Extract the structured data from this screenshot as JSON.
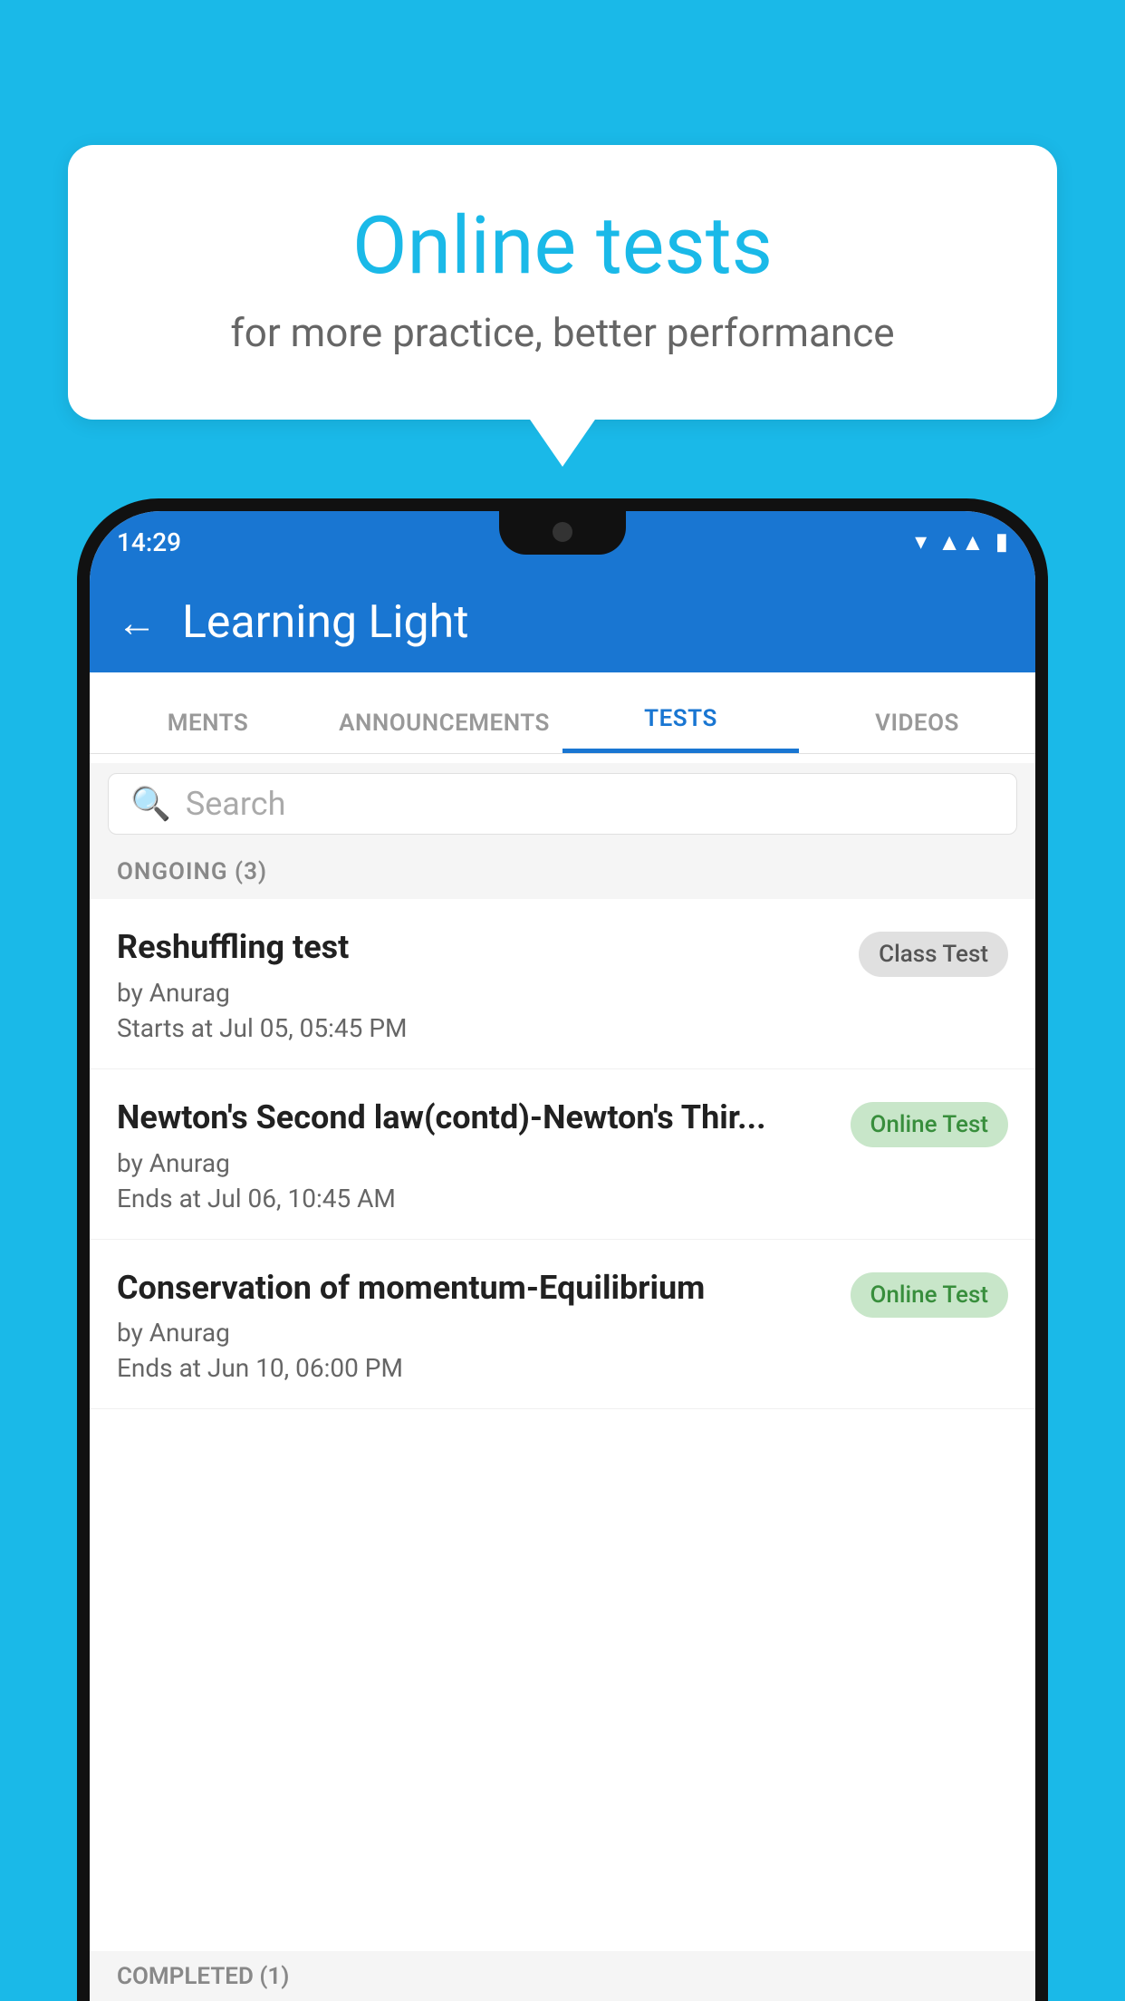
{
  "bubble": {
    "title": "Online tests",
    "subtitle": "for more practice, better performance"
  },
  "statusBar": {
    "time": "14:29",
    "icons": [
      "wifi",
      "signal",
      "battery"
    ]
  },
  "appBar": {
    "title": "Learning Light",
    "backLabel": "←"
  },
  "tabs": [
    {
      "label": "MENTS",
      "active": false
    },
    {
      "label": "ANNOUNCEMENTS",
      "active": false
    },
    {
      "label": "TESTS",
      "active": true
    },
    {
      "label": "VIDEOS",
      "active": false
    }
  ],
  "search": {
    "placeholder": "Search"
  },
  "sections": [
    {
      "label": "ONGOING (3)",
      "tests": [
        {
          "title": "Reshuffling test",
          "author": "by Anurag",
          "date": "Starts at  Jul 05, 05:45 PM",
          "badge": "Class Test",
          "badgeType": "class"
        },
        {
          "title": "Newton's Second law(contd)-Newton's Thir...",
          "author": "by Anurag",
          "date": "Ends at  Jul 06, 10:45 AM",
          "badge": "Online Test",
          "badgeType": "online"
        },
        {
          "title": "Conservation of momentum-Equilibrium",
          "author": "by Anurag",
          "date": "Ends at  Jun 10, 06:00 PM",
          "badge": "Online Test",
          "badgeType": "online"
        }
      ]
    }
  ],
  "completedSection": {
    "label": "COMPLETED (1)"
  }
}
